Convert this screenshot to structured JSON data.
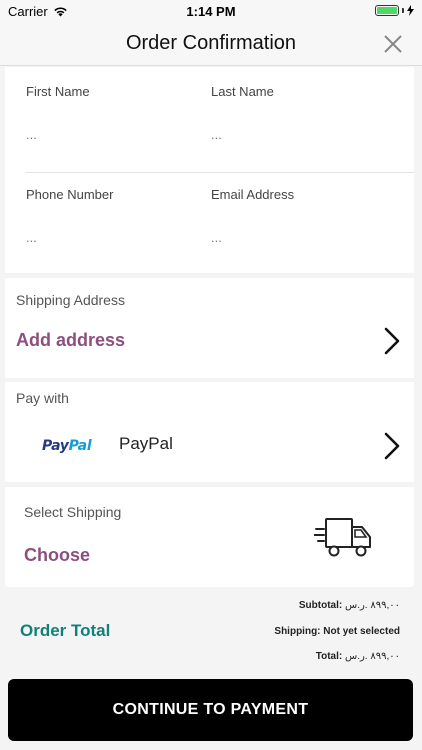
{
  "status_bar": {
    "carrier": "Carrier",
    "time": "1:14 PM"
  },
  "nav": {
    "title": "Order Confirmation",
    "close_icon": "close-icon"
  },
  "form": {
    "first_name": {
      "label": "First Name",
      "placeholder": "..."
    },
    "last_name": {
      "label": "Last Name",
      "placeholder": "..."
    },
    "phone": {
      "label": "Phone Number",
      "placeholder": "..."
    },
    "email": {
      "label": "Email Address",
      "placeholder": "..."
    }
  },
  "shipping_address": {
    "label": "Shipping Address",
    "action": "Add address"
  },
  "payment": {
    "label": "Pay with",
    "logo_pay": "Pay",
    "logo_pal": "Pal",
    "method": "PayPal"
  },
  "shipping_method": {
    "label": "Select Shipping",
    "action": "Choose",
    "icon": "delivery-truck-icon"
  },
  "totals": {
    "label": "Order Total",
    "subtotal_label": "Subtotal:",
    "subtotal_value": "٨٩٩,٠٠ .ر.س",
    "shipping_label": "Shipping:",
    "shipping_value": "Not yet selected",
    "total_label": "Total:",
    "total_value": "٨٩٩,٠٠ .ر.س"
  },
  "cta": {
    "label": "CONTINUE TO PAYMENT"
  },
  "colors": {
    "accent_purple": "#8c4f7f",
    "accent_teal": "#12807a",
    "battery_green": "#4cd964"
  }
}
